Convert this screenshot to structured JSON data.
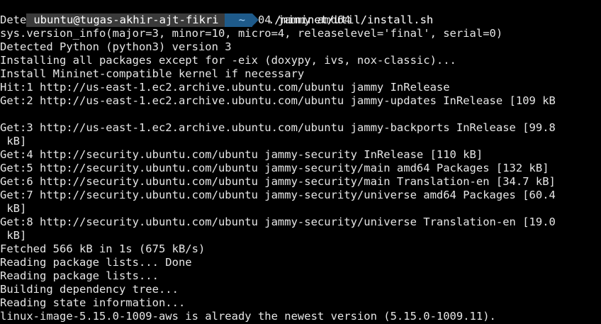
{
  "prompt": {
    "user_host": "ubuntu@tugas-akhir-ajt-fikri",
    "cwd": "~",
    "command": "./mininet/util/install.sh"
  },
  "output_lines": [
    "Detected Linux distribution: Ubuntu 22.04 jammy amd64",
    "sys.version_info(major=3, minor=10, micro=4, releaselevel='final', serial=0)",
    "Detected Python (python3) version 3",
    "Installing all packages except for -eix (doxypy, ivs, nox-classic)...",
    "Install Mininet-compatible kernel if necessary",
    "Hit:1 http://us-east-1.ec2.archive.ubuntu.com/ubuntu jammy InRelease",
    "Get:2 http://us-east-1.ec2.archive.ubuntu.com/ubuntu jammy-updates InRelease [109 kB",
    "",
    "Get:3 http://us-east-1.ec2.archive.ubuntu.com/ubuntu jammy-backports InRelease [99.8",
    " kB]",
    "Get:4 http://security.ubuntu.com/ubuntu jammy-security InRelease [110 kB]",
    "Get:5 http://security.ubuntu.com/ubuntu jammy-security/main amd64 Packages [132 kB]",
    "Get:6 http://security.ubuntu.com/ubuntu jammy-security/main Translation-en [34.7 kB]",
    "Get:7 http://security.ubuntu.com/ubuntu jammy-security/universe amd64 Packages [60.4",
    " kB]",
    "Get:8 http://security.ubuntu.com/ubuntu jammy-security/universe Translation-en [19.0",
    " kB]",
    "Fetched 566 kB in 1s (675 kB/s)",
    "Reading package lists... Done",
    "Reading package lists...",
    "Building dependency tree...",
    "Reading state information...",
    "linux-image-5.15.0-1009-aws is already the newest version (5.15.0-1009.11)."
  ],
  "colors": {
    "background": "#000000",
    "text": "#e6e6e6",
    "user_segment_bg": "#3a3a3a",
    "dir_segment_bg": "#1e5a8a"
  }
}
